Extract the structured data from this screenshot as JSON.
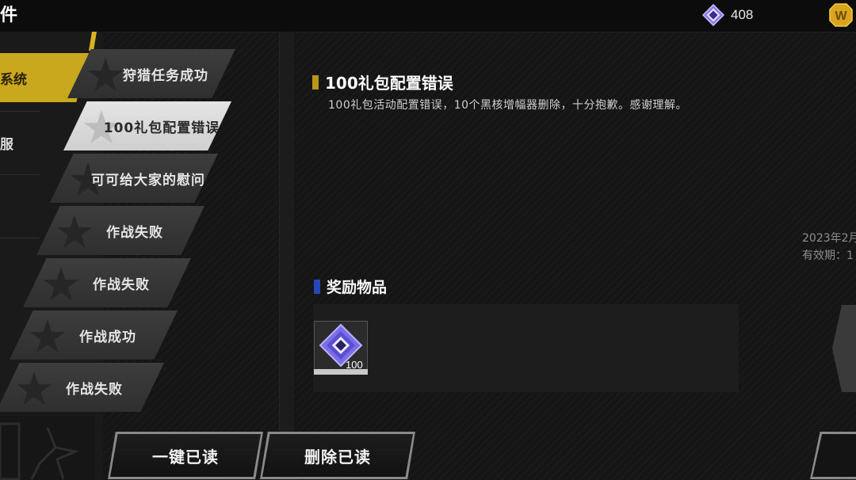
{
  "header": {
    "title": "件",
    "currency_icon": "purple-gem-icon",
    "currency_value": "408",
    "gold_icon": "gold-coin-icon",
    "gold_letter": "W"
  },
  "categories": [
    {
      "label": "系统",
      "active": true
    },
    {
      "label": "服",
      "active": false
    }
  ],
  "mail_list": [
    {
      "label": "狩猎任务成功",
      "selected": false
    },
    {
      "label": "100礼包配置错误",
      "selected": true
    },
    {
      "label": "可可给大家的慰问",
      "selected": false
    },
    {
      "label": "作战失败",
      "selected": false
    },
    {
      "label": "作战失败",
      "selected": false
    },
    {
      "label": "作战成功",
      "selected": false
    },
    {
      "label": "作战失败",
      "selected": false
    }
  ],
  "mail_detail": {
    "title": "100礼包配置错误",
    "title_bar_color": "#b9961a",
    "body": "100礼包活动配置错误，10个黑核增幅器删除，十分抱歉。感谢理解。",
    "date": "2023年2月",
    "validity": "有效期：1"
  },
  "rewards": {
    "heading": "奖励物品",
    "heading_bar_color": "#2448b8",
    "items": [
      {
        "icon": "purple-gem-icon",
        "quantity": "100"
      }
    ]
  },
  "buttons": {
    "read_all": "一键已读",
    "delete_read": "删除已读"
  }
}
